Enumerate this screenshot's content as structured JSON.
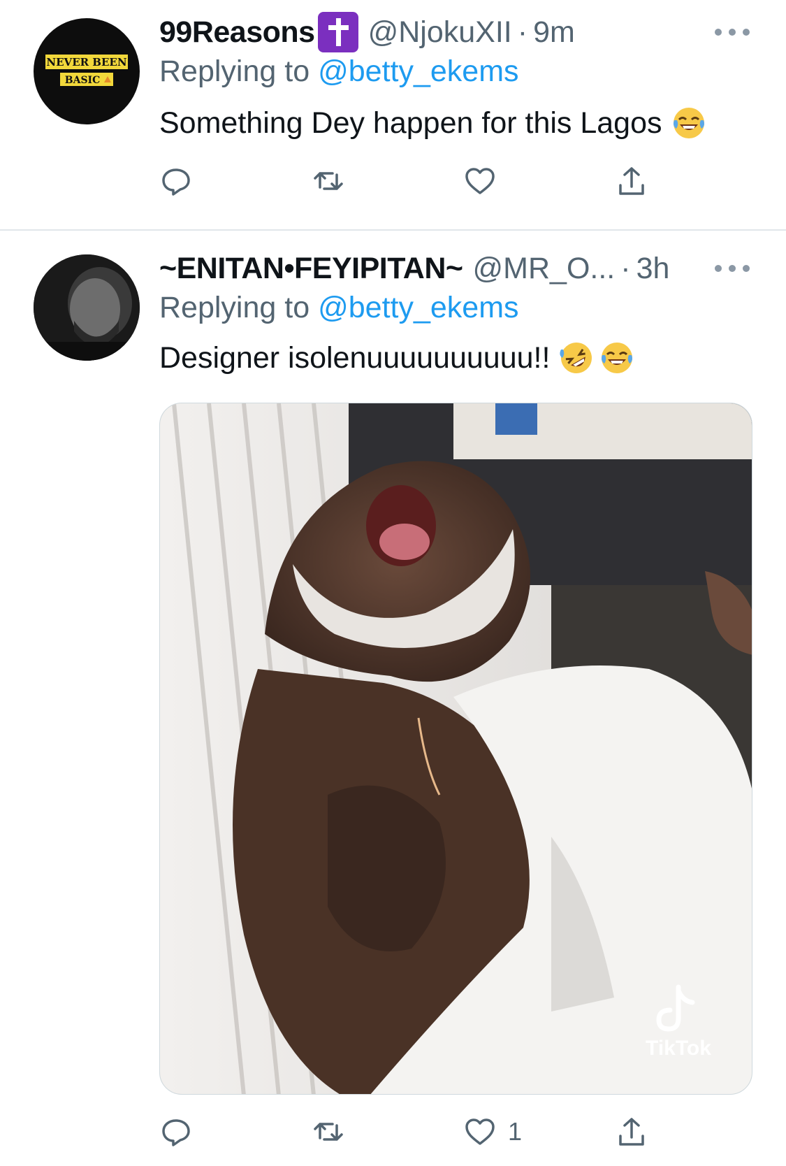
{
  "tweets": [
    {
      "name": "99Reasons",
      "badge_icon": "latin-cross-emoji",
      "handle": "@NjokuXII",
      "dot": "·",
      "time": "9m",
      "reply_prefix": "Replying to",
      "reply_to": "@betty_ekems",
      "text": "Something Dey happen for this Lagos",
      "emojis": [
        "face-with-tears-of-joy"
      ],
      "avatar_text": [
        "NEVER BEEN",
        "BASIC"
      ],
      "likes": ""
    },
    {
      "name": "~ENITAN•FEYIPITAN~",
      "handle": "@MR_O...",
      "dot": "·",
      "time": "3h",
      "reply_prefix": "Replying to",
      "reply_to": "@betty_ekems",
      "text": "Designer isolenuuuuuuuuuu!!",
      "emojis": [
        "rolling-on-the-floor-laughing",
        "face-with-tears-of-joy"
      ],
      "media_watermark": "TikTok",
      "likes": "1"
    }
  ],
  "colors": {
    "link": "#1d9bf0",
    "secondary": "#536471",
    "icon": "#536471",
    "divider": "#e1e6ea"
  }
}
